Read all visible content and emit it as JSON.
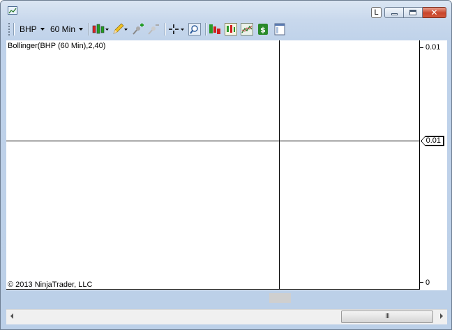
{
  "titlebar": {
    "l_button": "L",
    "close_glyph": "✕"
  },
  "toolbar": {
    "instrument": "BHP",
    "interval": "60 Min",
    "icons": [
      "bar-type-icon",
      "draw-tool-icon",
      "add-indicator-icon",
      "remove-indicator-icon",
      "crosshair-icon",
      "zoom-icon",
      "strategy-icon",
      "properties-icon",
      "chart-trader-icon",
      "money-icon",
      "template-icon"
    ]
  },
  "chart": {
    "indicator_label": "Bollinger(BHP (60 Min),2,40)",
    "copyright": "© 2013 NinjaTrader, LLC",
    "axis_labels": [
      "0.01",
      "0"
    ],
    "price_marker": "0.01"
  },
  "scrollbar": {
    "thumb_grip": "III"
  },
  "colors": {
    "window_bg": "#bcd0e8",
    "chart_bg": "#ffffff",
    "close_button": "#c8442a"
  }
}
